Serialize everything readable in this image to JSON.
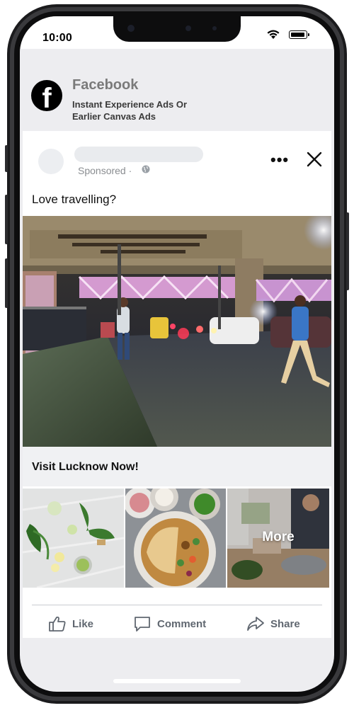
{
  "status_bar": {
    "time": "10:00"
  },
  "format_header": {
    "brand": "Facebook",
    "subtitle": "Instant Experience Ads Or Earlier Canvas Ads",
    "logo_letter": "f"
  },
  "post": {
    "sponsored_label": "Sponsored ·",
    "more_label": "•••",
    "text": "Love travelling?",
    "headline": "Visit Lucknow Now!",
    "carousel_more_label": "More",
    "actions": {
      "like": "Like",
      "comment": "Comment",
      "share": "Share"
    }
  },
  "colors": {
    "action_text": "#606770",
    "placeholder": "#e9ebee",
    "screen_bg": "#ededf0"
  }
}
